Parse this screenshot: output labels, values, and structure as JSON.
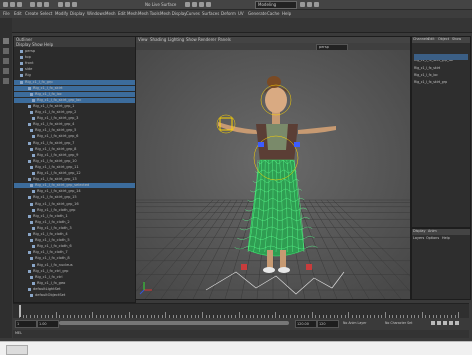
{
  "window": {
    "title": "Autodesk Maya"
  },
  "menubar": {
    "items": [
      "File",
      "Edit",
      "Create",
      "Select",
      "Modify",
      "Display",
      "Windows",
      "Mesh",
      "Edit Mesh",
      "Mesh Tools",
      "Mesh Display",
      "Curves",
      "Surfaces",
      "Deform",
      "UV",
      "Generate",
      "Cache",
      "Help"
    ]
  },
  "statusline": {
    "mode": "Modeling",
    "live": "No Live Surface"
  },
  "outliner": {
    "title": "Outliner",
    "menus": [
      "Display",
      "Show",
      "Help"
    ],
    "rows": [
      {
        "label": "persp",
        "selected": false
      },
      {
        "label": "top",
        "selected": false
      },
      {
        "label": "front",
        "selected": false
      },
      {
        "label": "side",
        "selected": false
      },
      {
        "label": "Rig",
        "selected": false
      },
      {
        "label": "Rig_c1_I_fx_grp",
        "selected": true
      },
      {
        "label": "Rig_c1_I_fx_skirt",
        "selected": true
      },
      {
        "label": "Rig_c1_I_fx_loc",
        "selected": true
      },
      {
        "label": "Rig_c1_I_fx_skirt_grp_loc",
        "selected": true
      },
      {
        "label": "Rig_c1_I_fx_skirt_grp_1",
        "selected": false
      },
      {
        "label": "Rig_c1_I_fx_skirt_grp_2",
        "selected": false
      },
      {
        "label": "Rig_c1_I_fx_skirt_grp_3",
        "selected": false
      },
      {
        "label": "Rig_c1_I_fx_skirt_grp_4",
        "selected": false
      },
      {
        "label": "Rig_c1_I_fx_skirt_grp_5",
        "selected": false
      },
      {
        "label": "Rig_c1_I_fx_skirt_grp_6",
        "selected": false
      },
      {
        "label": "Rig_c1_I_fx_skirt_grp_7",
        "selected": false
      },
      {
        "label": "Rig_c1_I_fx_skirt_grp_8",
        "selected": false
      },
      {
        "label": "Rig_c1_I_fx_skirt_grp_9",
        "selected": false
      },
      {
        "label": "Rig_c1_I_fx_skirt_grp_10",
        "selected": false
      },
      {
        "label": "Rig_c1_I_fx_skirt_grp_11",
        "selected": false
      },
      {
        "label": "Rig_c1_I_fx_skirt_grp_12",
        "selected": false
      },
      {
        "label": "Rig_c1_I_fx_skirt_grp_13",
        "selected": false
      },
      {
        "label": "Rig_c1_I_fx_skirt_grp_selected",
        "selected": true
      },
      {
        "label": "Rig_c1_I_fx_skirt_grp_14",
        "selected": false
      },
      {
        "label": "Rig_c1_I_fx_skirt_grp_15",
        "selected": false
      },
      {
        "label": "Rig_c1_I_fx_skirt_grp_16",
        "selected": false
      },
      {
        "label": "Rig_c1_I_fx_cloth_grp",
        "selected": false
      },
      {
        "label": "Rig_c1_I_fx_cloth_1",
        "selected": false
      },
      {
        "label": "Rig_c1_I_fx_cloth_2",
        "selected": false
      },
      {
        "label": "Rig_c1_I_fx_cloth_3",
        "selected": false
      },
      {
        "label": "Rig_c1_I_fx_cloth_4",
        "selected": false
      },
      {
        "label": "Rig_c1_I_fx_cloth_5",
        "selected": false
      },
      {
        "label": "Rig_c1_I_fx_cloth_6",
        "selected": false
      },
      {
        "label": "Rig_c1_I_fx_cloth_7",
        "selected": false
      },
      {
        "label": "Rig_c1_I_fx_cloth_8",
        "selected": false
      },
      {
        "label": "Rig_c1_I_fx_nucleus",
        "selected": false
      },
      {
        "label": "Rig_c1_I_fx_ctrl_grp",
        "selected": false
      },
      {
        "label": "Rig_c1_I_fx_ctrl",
        "selected": false
      },
      {
        "label": "Rig_c1_I_fx_geo",
        "selected": false
      },
      {
        "label": "defaultLightSet",
        "selected": false
      },
      {
        "label": "defaultObjectSet",
        "selected": false
      }
    ]
  },
  "viewport": {
    "menus": [
      "View",
      "Shading",
      "Lighting",
      "Show",
      "Renderer",
      "Panels"
    ],
    "camera_label": "persp"
  },
  "channelbox": {
    "tabs": [
      "Channels",
      "Edit",
      "Object",
      "Show"
    ],
    "object_name": "Rig_c1_I_fx_skirt_grp_loc",
    "rows": [
      "Rig_c1_I_fx_skirt",
      "Rig_c1_I_fx_loc",
      "Rig_c1_I_fx_skirt_grp"
    ]
  },
  "layers": {
    "tabs": [
      "Display",
      "Anim"
    ],
    "menus": [
      "Layers",
      "Options",
      "Help"
    ]
  },
  "timeline": {
    "start": "1",
    "end": "120",
    "range_start": "1.00",
    "range_end": "120.00",
    "current": "1",
    "char_set": "No Character Set",
    "anim_layer": "No Anim Layer"
  },
  "cmdline": {
    "label": "MEL"
  },
  "taskbar": {
    "start_label": ""
  },
  "colors": {
    "accent": "#4a78b0",
    "selection": "#3c6c9c",
    "wire_green": "#39e86e"
  }
}
